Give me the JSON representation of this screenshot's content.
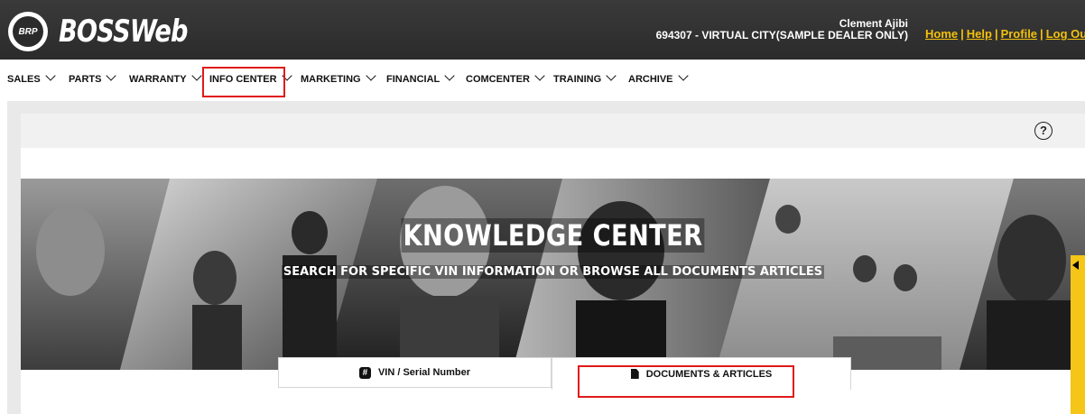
{
  "header": {
    "logo_text": "BRP",
    "app_title": "BOSSWeb",
    "user_name": "Clement Ajibi",
    "dealer": "694307 - VIRTUAL CITY(SAMPLE DEALER ONLY)",
    "links": [
      "Home",
      "Help",
      "Profile",
      "Log Out"
    ]
  },
  "nav": {
    "items": [
      "SALES",
      "PARTS",
      "WARRANTY",
      "INFO CENTER",
      "MARKETING",
      "FINANCIAL",
      "COMCENTER",
      "TRAINING",
      "ARCHIVE"
    ],
    "highlighted": "INFO CENTER"
  },
  "panel": {
    "help_icon_glyph": "?"
  },
  "hero": {
    "title": "KNOWLEDGE CENTER",
    "subtitle": "SEARCH FOR SPECIFIC VIN INFORMATION OR BROWSE ALL DOCUMENTS ARTICLES"
  },
  "tabs": [
    {
      "label": "VIN / Serial Number",
      "icon": "hash-icon"
    },
    {
      "label": "DOCUMENTS & ARTICLES",
      "icon": "document-icon",
      "active": true
    }
  ],
  "colors": {
    "topbar": "#2b2b2b",
    "link": "#f3c10b",
    "highlight": "#e01a1a",
    "feedback_tab": "#f5c518"
  }
}
